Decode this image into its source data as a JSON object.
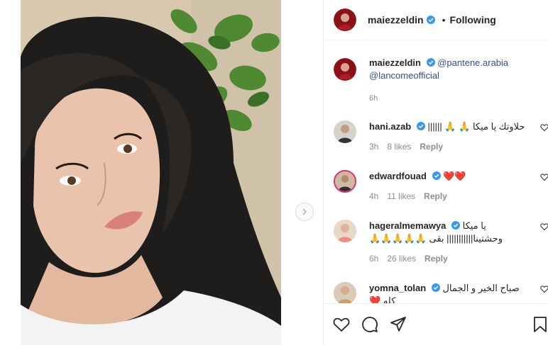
{
  "post": {
    "author": "maiezzeldin",
    "separator": "•",
    "follow_status": "Following"
  },
  "caption": {
    "author": "maiezzeldin",
    "mention_1": "@pantene.arabia",
    "mention_2": "@lancomeofficial",
    "time": "6h"
  },
  "comments": [
    {
      "user": "hani.azab",
      "text": "حلاوتك يا ميكا 🙏 🙏 ||||||",
      "time": "3h",
      "likes": "8 likes",
      "reply": "Reply"
    },
    {
      "user": "edwardfouad",
      "text": "❤️❤️",
      "time": "4h",
      "likes": "11 likes",
      "reply": "Reply"
    },
    {
      "user": "hageralmemawya",
      "text": "يا ميكا وحشتينا||||||||||| بقى 🙏🙏🙏🙏🙏",
      "time": "6h",
      "likes": "26 likes",
      "reply": "Reply"
    },
    {
      "user": "yomna_tolan",
      "text": "صباح الخير و الجمال كله ❤️",
      "time": "",
      "likes": "",
      "reply": ""
    }
  ],
  "icons": {
    "next": "chevron-right-icon",
    "like": "heart-icon",
    "comment": "comment-icon",
    "share": "paper-plane-icon",
    "save": "bookmark-icon",
    "verified": "verified-badge-icon"
  },
  "colors": {
    "verified": "#3897f0",
    "link": "#385185",
    "muted": "#8e8e8e",
    "text": "#262626"
  }
}
